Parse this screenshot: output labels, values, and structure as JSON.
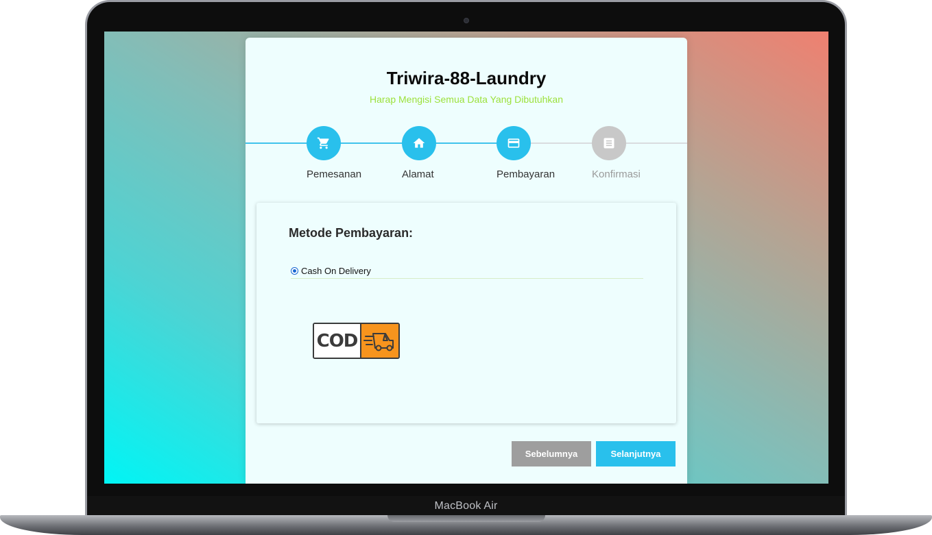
{
  "device": {
    "label": "MacBook Air"
  },
  "app": {
    "title": "Triwira-88-Laundry",
    "subtitle": "Harap Mengisi Semua Data Yang Dibutuhkan",
    "accent_color": "#29c0ec",
    "subtitle_color": "#9ce13b"
  },
  "stepper": {
    "steps": [
      {
        "label": "Pemesanan",
        "icon": "cart-icon",
        "status": "done"
      },
      {
        "label": "Alamat",
        "icon": "home-icon",
        "status": "done"
      },
      {
        "label": "Pembayaran",
        "icon": "credit-card-icon",
        "status": "active"
      },
      {
        "label": "Konfirmasi",
        "icon": "document-icon",
        "status": "pending"
      }
    ]
  },
  "payment": {
    "heading": "Metode Pembayaran:",
    "selected_option": "Cash On Delivery",
    "logo": {
      "text": "COD",
      "icon": "delivery-truck-icon",
      "color": "#f7941d"
    }
  },
  "actions": {
    "prev_label": "Sebelumnya",
    "next_label": "Selanjutnya"
  }
}
